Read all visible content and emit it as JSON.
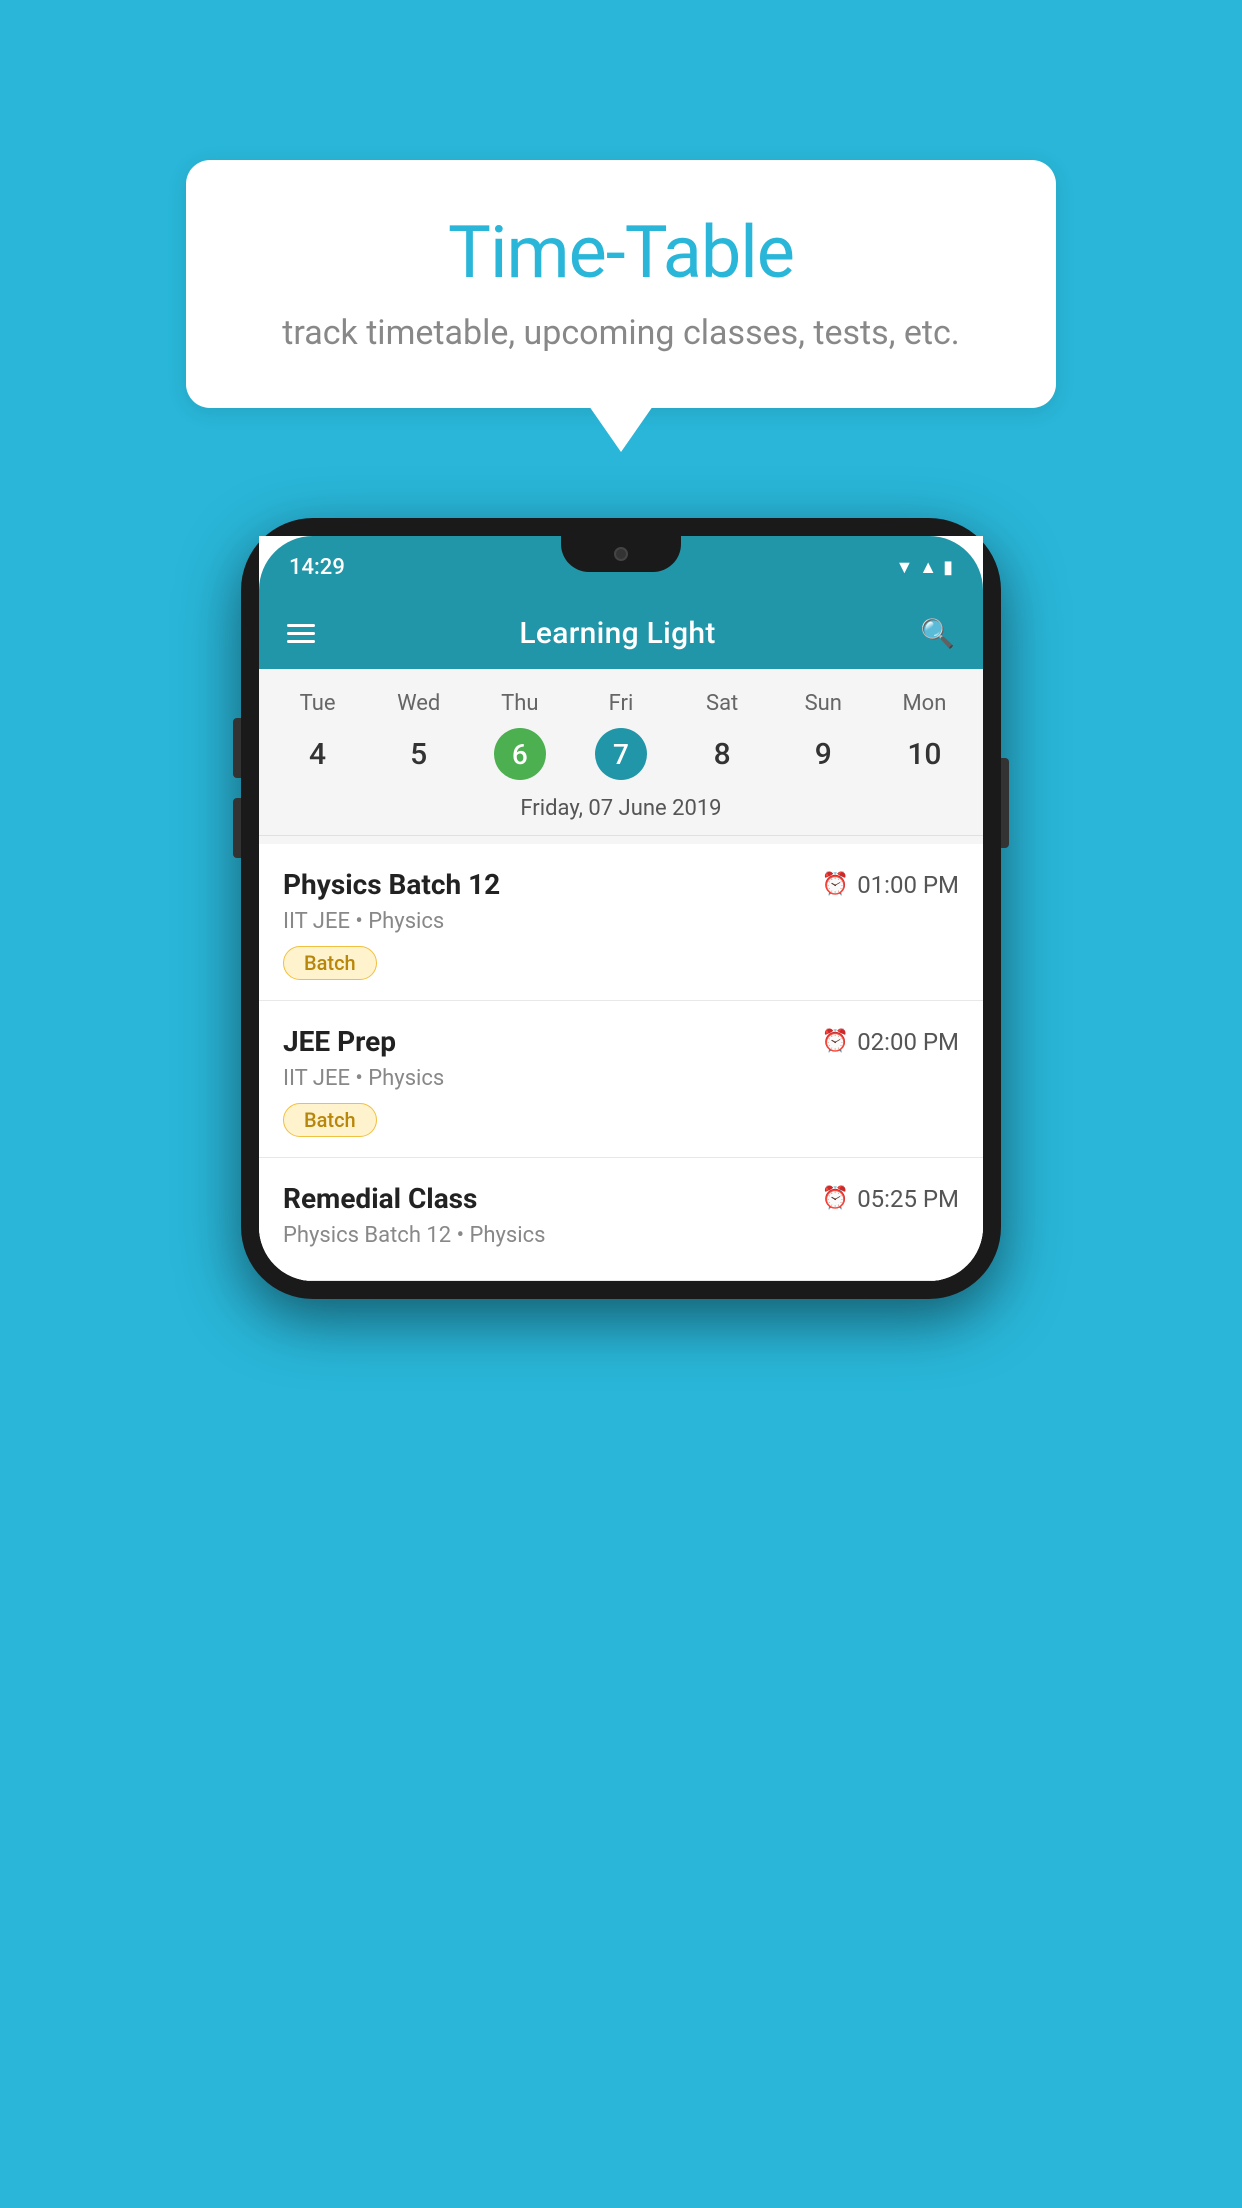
{
  "background": {
    "color": "#29B6D8"
  },
  "bubble": {
    "title": "Time-Table",
    "subtitle": "track timetable, upcoming classes, tests, etc."
  },
  "phone": {
    "status_bar": {
      "time": "14:29"
    },
    "app_bar": {
      "title": "Learning Light"
    },
    "calendar": {
      "days_of_week": [
        "Tue",
        "Wed",
        "Thu",
        "Fri",
        "Sat",
        "Sun",
        "Mon"
      ],
      "day_numbers": [
        "4",
        "5",
        "6",
        "7",
        "8",
        "9",
        "10"
      ],
      "today_index": 2,
      "selected_index": 3,
      "selected_date_label": "Friday, 07 June 2019"
    },
    "classes": [
      {
        "name": "Physics Batch 12",
        "time": "01:00 PM",
        "meta": "IIT JEE • Physics",
        "tag": "Batch"
      },
      {
        "name": "JEE Prep",
        "time": "02:00 PM",
        "meta": "IIT JEE • Physics",
        "tag": "Batch"
      },
      {
        "name": "Remedial Class",
        "time": "05:25 PM",
        "meta": "Physics Batch 12 • Physics",
        "tag": ""
      }
    ]
  }
}
